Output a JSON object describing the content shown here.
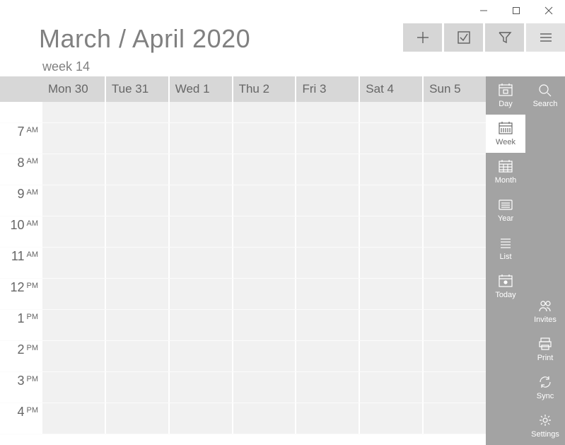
{
  "title": "March / April 2020",
  "week_label": "week 14",
  "days": [
    {
      "label": "Mon 30"
    },
    {
      "label": "Tue 31"
    },
    {
      "label": "Wed 1"
    },
    {
      "label": "Thu 2"
    },
    {
      "label": "Fri 3"
    },
    {
      "label": "Sat 4"
    },
    {
      "label": "Sun 5"
    }
  ],
  "time_slots": [
    {
      "hour": "7",
      "ampm": "AM"
    },
    {
      "hour": "8",
      "ampm": "AM"
    },
    {
      "hour": "9",
      "ampm": "AM"
    },
    {
      "hour": "10",
      "ampm": "AM"
    },
    {
      "hour": "11",
      "ampm": "AM"
    },
    {
      "hour": "12",
      "ampm": "PM"
    },
    {
      "hour": "1",
      "ampm": "PM"
    },
    {
      "hour": "2",
      "ampm": "PM"
    },
    {
      "hour": "3",
      "ampm": "PM"
    },
    {
      "hour": "4",
      "ampm": "PM"
    }
  ],
  "views": {
    "day": {
      "label": "Day",
      "active": false
    },
    "week": {
      "label": "Week",
      "active": true
    },
    "month": {
      "label": "Month",
      "active": false
    },
    "year": {
      "label": "Year",
      "active": false
    },
    "list": {
      "label": "List",
      "active": false
    },
    "today": {
      "label": "Today",
      "active": false
    }
  },
  "right_actions": {
    "search": {
      "label": "Search"
    },
    "invites": {
      "label": "Invites"
    },
    "print": {
      "label": "Print"
    },
    "sync": {
      "label": "Sync"
    },
    "settings": {
      "label": "Settings"
    }
  }
}
